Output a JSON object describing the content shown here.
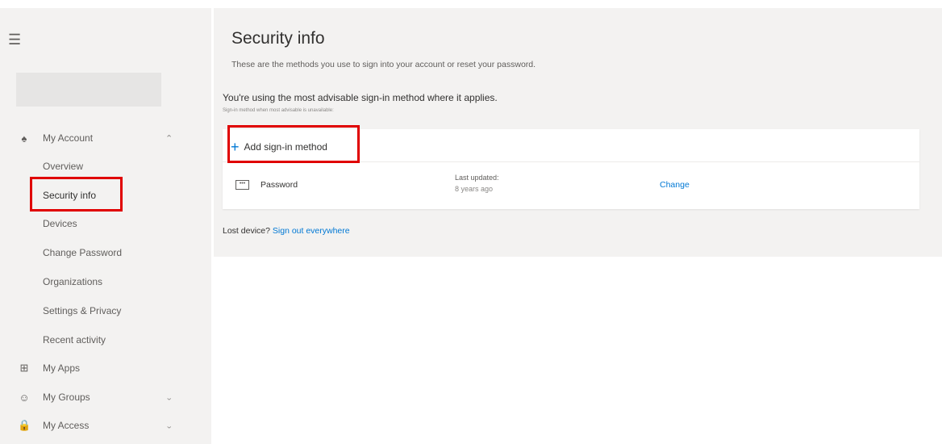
{
  "sidebar": {
    "menu_icon": "hamburger-icon",
    "items": [
      {
        "label": "My Account",
        "icon": "person-icon",
        "chevron": "up"
      },
      {
        "label": "Overview"
      },
      {
        "label": "Security info",
        "active": true
      },
      {
        "label": "Devices"
      },
      {
        "label": "Change Password"
      },
      {
        "label": "Organizations"
      },
      {
        "label": "Settings & Privacy"
      },
      {
        "label": "Recent activity"
      },
      {
        "label": "My Apps",
        "icon": "apps-grid-icon"
      },
      {
        "label": "My Groups",
        "icon": "groups-icon",
        "chevron": "down"
      },
      {
        "label": "My Access",
        "icon": "lock-icon",
        "chevron": "down"
      }
    ]
  },
  "main": {
    "title": "Security info",
    "subtitle": "These are the methods you use to sign into your account or reset your password.",
    "advice": "You're using the most advisable sign-in method where it applies.",
    "advice_small": "Sign-in method when most advisable is unavailable:",
    "add_method_label": "Add sign-in method",
    "methods": [
      {
        "icon": "password-icon",
        "name": "Password",
        "last_updated_label": "Last updated:",
        "last_updated_value": "8 years ago",
        "action": "Change"
      }
    ],
    "lost_device_prefix": "Lost device?",
    "sign_out_link": "Sign out everywhere"
  },
  "colors": {
    "highlight": "#e00000",
    "link": "#0078d4",
    "panel": "#f3f2f1"
  }
}
